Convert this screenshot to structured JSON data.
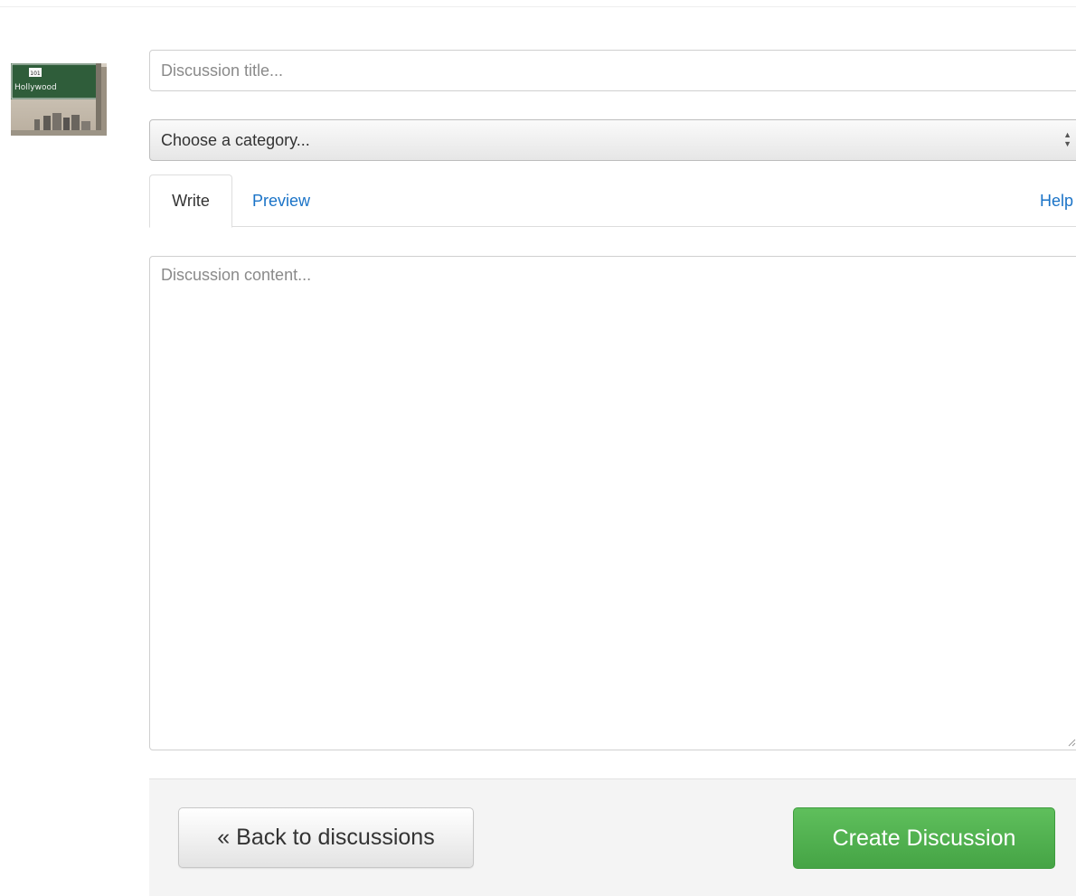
{
  "avatar": {
    "sign_shield": "101",
    "sign_text": "Hollywood"
  },
  "form": {
    "title_placeholder": "Discussion title...",
    "category_selected": "Choose a category...",
    "content_placeholder": "Discussion content..."
  },
  "tabs": {
    "write": "Write",
    "preview": "Preview",
    "help": "Help"
  },
  "actions": {
    "back": "« Back to discussions",
    "create": "Create Discussion"
  },
  "colors": {
    "link": "#1a73c7",
    "create_button": "#4cae4c"
  },
  "icons": {
    "select_arrows": "updown-arrows-icon",
    "resize": "resize-grip-icon"
  }
}
